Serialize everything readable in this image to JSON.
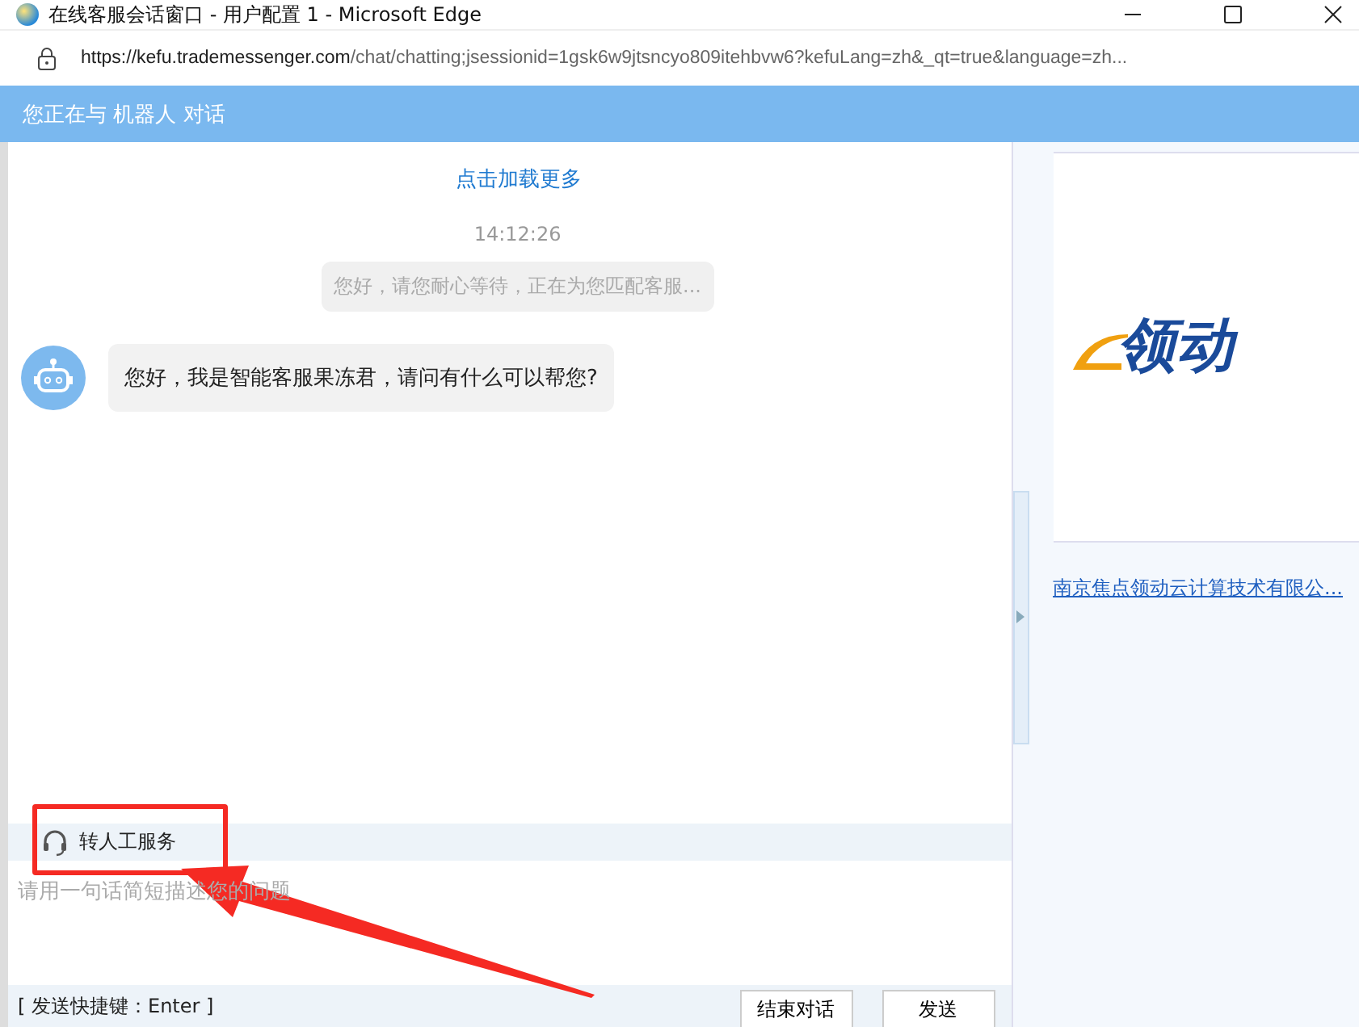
{
  "window": {
    "title": "在线客服会话窗口 - 用户配置 1 - Microsoft Edge",
    "url_host": "https://kefu.trademessenger.com",
    "url_path": "/chat/chatting;jsessionid=1gsk6w9jtsncyo809itehbvw6?kefuLang=zh&_qt=true&language=zh..."
  },
  "header": {
    "text": "您正在与 机器人 对话"
  },
  "chat": {
    "load_more": "点击加载更多",
    "time": "14:12:26",
    "messages": [
      {
        "kind": "system",
        "text": "您好，请您耐心等待，正在为您匹配客服..."
      },
      {
        "kind": "bot",
        "text": "您好，我是智能客服果冻君，请问有什么可以帮您?"
      }
    ]
  },
  "toolbar": {
    "human_service": "转人工服务"
  },
  "input": {
    "placeholder": "请用一句话简短描述您的问题"
  },
  "footer": {
    "hint": "[ 发送快捷键：Enter ]",
    "buttons": [
      {
        "label": "结束对话"
      },
      {
        "label": "发送"
      }
    ]
  },
  "side": {
    "logo_text": "领动",
    "company_link": "南京焦点领动云计算技术有限公..."
  }
}
